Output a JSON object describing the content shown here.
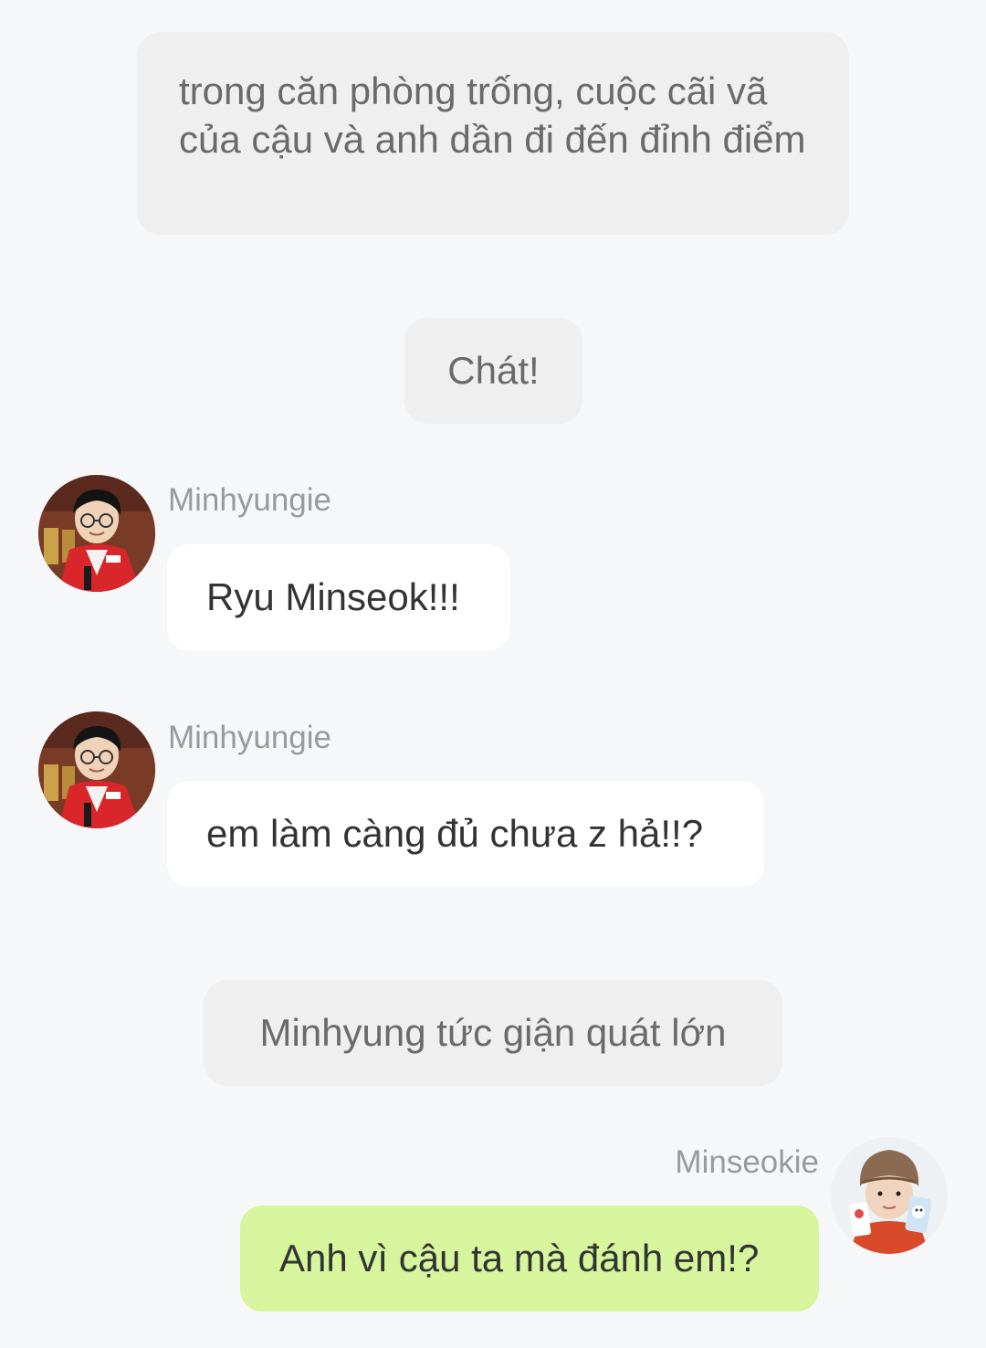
{
  "colors": {
    "background": "#f6f7f9",
    "narration_bubble": "#efefef",
    "incoming_bubble": "#ffffff",
    "outgoing_bubble": "#d6f59c"
  },
  "messages": {
    "narration_1": "trong căn phòng trống, cuộc cãi vã của cậu và anh dần đi đến đỉnh điểm",
    "narration_2": "Chát!",
    "incoming_1": {
      "sender": "Minhyungie",
      "text": "Ryu Minseok!!!"
    },
    "incoming_2": {
      "sender": "Minhyungie",
      "text": "em làm càng đủ chưa z hả!!?"
    },
    "narration_3": "Minhyung tức giận quát lớn",
    "outgoing_1": {
      "sender": "Minseokie",
      "text": "Anh vì cậu ta mà đánh em!?"
    }
  }
}
